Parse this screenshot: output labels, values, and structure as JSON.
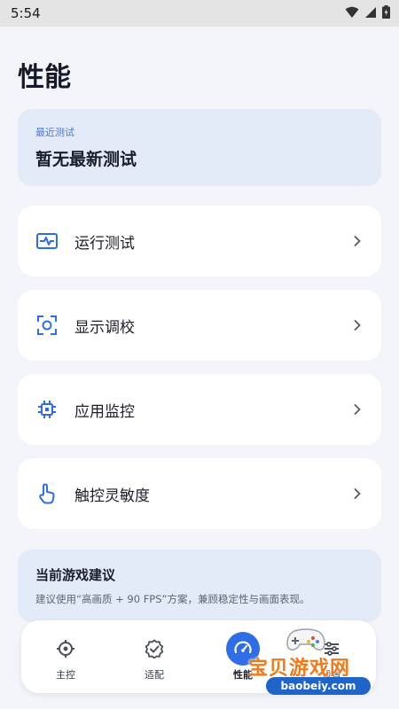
{
  "status_bar": {
    "time": "5:54"
  },
  "page": {
    "title": "性能"
  },
  "recent_test": {
    "label": "最近测试",
    "value": "暂无最新测试"
  },
  "menu": [
    {
      "label": "运行测试",
      "icon": "waveform-icon"
    },
    {
      "label": "显示调校",
      "icon": "display-scan-icon"
    },
    {
      "label": "应用监控",
      "icon": "chip-icon"
    },
    {
      "label": "触控灵敏度",
      "icon": "touch-hand-icon"
    }
  ],
  "tip": {
    "title": "当前游戏建议",
    "body": "建议使用“高画质 + 90 FPS”方案，兼顾稳定性与画面表现。"
  },
  "bottom_nav": [
    {
      "label": "主控",
      "icon": "target-icon",
      "active": false
    },
    {
      "label": "适配",
      "icon": "badge-check-icon",
      "active": false
    },
    {
      "label": "性能",
      "icon": "speedometer-icon",
      "active": true
    },
    {
      "label": "设置",
      "icon": "settings-icon",
      "active": false
    }
  ],
  "watermark": {
    "text": "宝贝游戏网",
    "url": "baobeiy.com"
  },
  "colors": {
    "accent": "#2e6de6",
    "card_tint": "#e3ebf9",
    "background": "#f3f5fa"
  }
}
